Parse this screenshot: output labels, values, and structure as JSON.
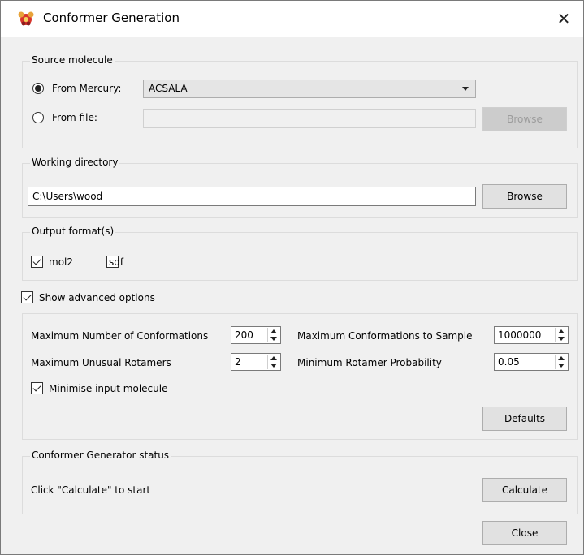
{
  "window": {
    "title": "Conformer Generation",
    "close_glyph": "✕"
  },
  "source": {
    "legend": "Source molecule",
    "from_mercury_label": "From Mercury:",
    "mercury_selected": "ACSALA",
    "from_file_label": "From file:",
    "file_value": "",
    "browse_label": "Browse"
  },
  "working_dir": {
    "legend": "Working directory",
    "path": "C:\\Users\\wood",
    "browse_label": "Browse"
  },
  "output": {
    "legend": "Output format(s)",
    "mol2_label": "mol2",
    "mol2_checked": true,
    "sdf_label": "sdf",
    "sdf_checked": false
  },
  "advanced": {
    "show_label": "Show advanced options",
    "show_checked": true,
    "max_conformations_label": "Maximum Number of Conformations",
    "max_conformations_value": "200",
    "max_unusual_rotamers_label": "Maximum Unusual Rotamers",
    "max_unusual_rotamers_value": "2",
    "max_sample_label": "Maximum Conformations to Sample",
    "max_sample_value": "1000000",
    "min_rotamer_prob_label": "Minimum Rotamer Probability",
    "min_rotamer_prob_value": "0.05",
    "minimise_label": "Minimise input molecule",
    "minimise_checked": true,
    "defaults_label": "Defaults"
  },
  "status": {
    "legend": "Conformer Generator status",
    "message": "Click \"Calculate\" to start",
    "calculate_label": "Calculate"
  },
  "footer": {
    "close_label": "Close"
  },
  "icons": {
    "app": "mercury-app-icon"
  },
  "colors": {
    "window_bg": "#f0f0f0",
    "titlebar_bg": "#ffffff",
    "button_bg": "#e1e1e1"
  }
}
